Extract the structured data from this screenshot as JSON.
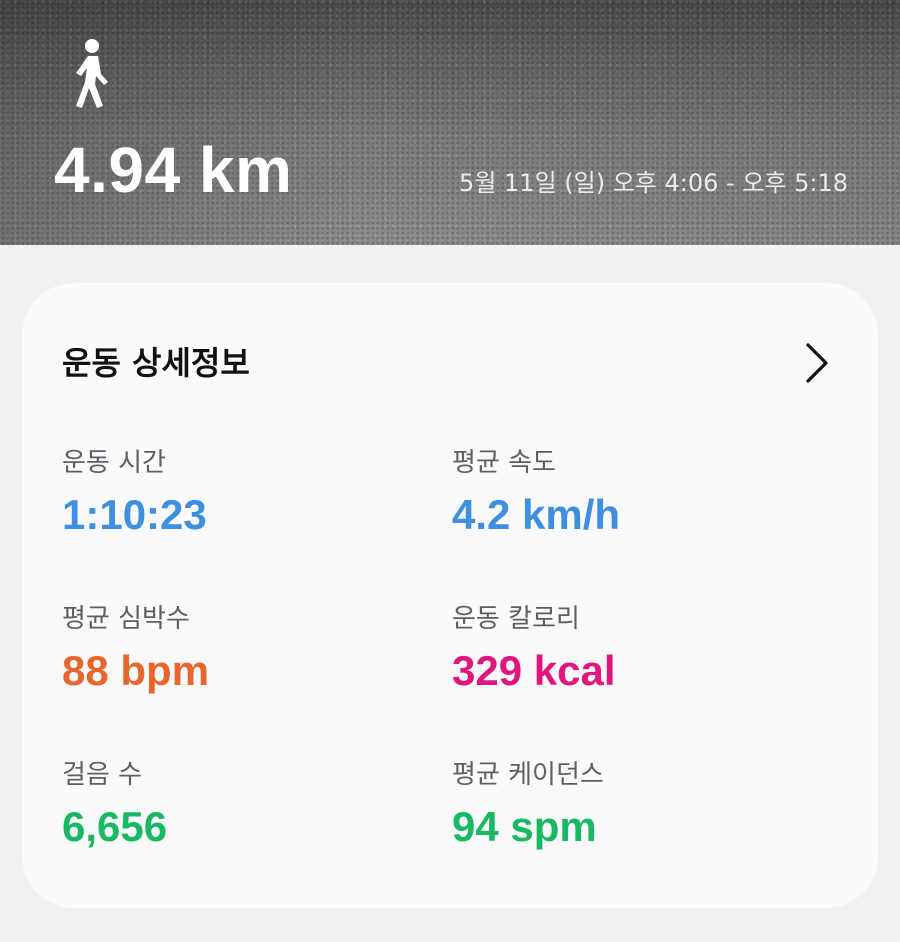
{
  "header": {
    "activity_icon": "walking-person-icon",
    "distance": "4.94 km",
    "time_range": "5월 11일 (일) 오후 4:06 - 오후 5:18"
  },
  "details": {
    "title": "운동 상세정보",
    "more_icon": "chevron-right-icon",
    "stats": [
      {
        "label": "운동 시간",
        "value": "1:10:23",
        "color": "#3f8fe0"
      },
      {
        "label": "평균 속도",
        "value": "4.2 km/h",
        "color": "#3f8fe0"
      },
      {
        "label": "평균 심박수",
        "value": "88 bpm",
        "color": "#e8652d"
      },
      {
        "label": "운동 칼로리",
        "value": "329 kcal",
        "color": "#e0157d"
      },
      {
        "label": "걸음 수",
        "value": "6,656",
        "color": "#19b862"
      },
      {
        "label": "평균 케이던스",
        "value": "94 spm",
        "color": "#19b862"
      }
    ]
  }
}
